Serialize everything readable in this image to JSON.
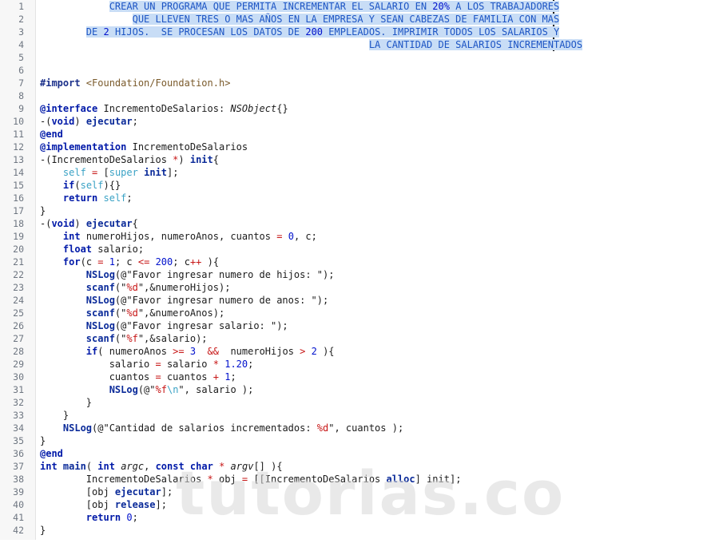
{
  "editor": {
    "watermark": "tutorias.co",
    "lines": [
      {
        "n": "1",
        "segs": [
          {
            "t": "            ",
            "c": ""
          },
          {
            "t": "CREAR UN PROGRAMA QUE PERMITA INCREMENTAR EL SALARIO EN ",
            "c": "c sel"
          },
          {
            "t": "20%",
            "c": "nm sel"
          },
          {
            "t": " A LOS TRABAJADORES",
            "c": "c sel"
          }
        ]
      },
      {
        "n": "2",
        "segs": [
          {
            "t": "                ",
            "c": ""
          },
          {
            "t": "QUE LLEVEN TRES O MAS AÑOS EN LA EMPRESA Y SEAN CABEZAS DE FAMILIA CON MAS",
            "c": "c sel"
          }
        ]
      },
      {
        "n": "3",
        "segs": [
          {
            "t": "        ",
            "c": ""
          },
          {
            "t": "DE ",
            "c": "c sel"
          },
          {
            "t": "2",
            "c": "nm sel"
          },
          {
            "t": " HIJOS.  SE PROCESAN LOS DATOS DE ",
            "c": "c sel"
          },
          {
            "t": "200",
            "c": "nm sel"
          },
          {
            "t": " EMPLEADOS. IMPRIMIR TODOS LOS SALARIOS Y",
            "c": "c sel"
          }
        ]
      },
      {
        "n": "4",
        "segs": [
          {
            "t": "                                                         ",
            "c": ""
          },
          {
            "t": "LA CANTIDAD DE SALARIOS INCREMENTADOS",
            "c": "c sel"
          }
        ]
      },
      {
        "n": "5",
        "segs": []
      },
      {
        "n": "6",
        "segs": []
      },
      {
        "n": "7",
        "segs": [
          {
            "t": "#import",
            "c": "dir"
          },
          {
            "t": " <Foundation/Foundation.h>",
            "c": "st"
          }
        ]
      },
      {
        "n": "8",
        "segs": []
      },
      {
        "n": "9",
        "segs": [
          {
            "t": "@interface",
            "c": "kw"
          },
          {
            "t": " IncrementoDeSalarios: ",
            "c": ""
          },
          {
            "t": "NSObject",
            "c": "it"
          },
          {
            "t": "{}",
            "c": ""
          }
        ]
      },
      {
        "n": "10",
        "segs": [
          {
            "t": "-(",
            "c": ""
          },
          {
            "t": "void",
            "c": "kw"
          },
          {
            "t": ") ",
            "c": ""
          },
          {
            "t": "ejecutar",
            "c": "fn"
          },
          {
            "t": ";",
            "c": ""
          }
        ]
      },
      {
        "n": "11",
        "segs": [
          {
            "t": "@end",
            "c": "kw"
          }
        ]
      },
      {
        "n": "12",
        "segs": [
          {
            "t": "@implementation",
            "c": "kw"
          },
          {
            "t": " IncrementoDeSalarios",
            "c": ""
          }
        ]
      },
      {
        "n": "13",
        "segs": [
          {
            "t": "-(IncrementoDeSalarios ",
            "c": ""
          },
          {
            "t": "*",
            "c": "op"
          },
          {
            "t": ") ",
            "c": ""
          },
          {
            "t": "init",
            "c": "fn"
          },
          {
            "t": "{",
            "c": ""
          }
        ]
      },
      {
        "n": "14",
        "segs": [
          {
            "t": "    ",
            "c": ""
          },
          {
            "t": "self",
            "c": "sf"
          },
          {
            "t": " ",
            "c": ""
          },
          {
            "t": "=",
            "c": "op"
          },
          {
            "t": " [",
            "c": ""
          },
          {
            "t": "super",
            "c": "sf"
          },
          {
            "t": " ",
            "c": ""
          },
          {
            "t": "init",
            "c": "fn"
          },
          {
            "t": "];",
            "c": ""
          }
        ]
      },
      {
        "n": "15",
        "segs": [
          {
            "t": "    ",
            "c": ""
          },
          {
            "t": "if",
            "c": "kw"
          },
          {
            "t": "(",
            "c": ""
          },
          {
            "t": "self",
            "c": "sf"
          },
          {
            "t": "){}",
            "c": ""
          }
        ]
      },
      {
        "n": "16",
        "segs": [
          {
            "t": "    ",
            "c": ""
          },
          {
            "t": "return",
            "c": "kw"
          },
          {
            "t": " ",
            "c": ""
          },
          {
            "t": "self",
            "c": "sf"
          },
          {
            "t": ";",
            "c": ""
          }
        ]
      },
      {
        "n": "17",
        "segs": [
          {
            "t": "}",
            "c": ""
          }
        ]
      },
      {
        "n": "18",
        "segs": [
          {
            "t": "-(",
            "c": ""
          },
          {
            "t": "void",
            "c": "kw"
          },
          {
            "t": ") ",
            "c": ""
          },
          {
            "t": "ejecutar",
            "c": "fn"
          },
          {
            "t": "{",
            "c": ""
          }
        ]
      },
      {
        "n": "19",
        "segs": [
          {
            "t": "    ",
            "c": ""
          },
          {
            "t": "int",
            "c": "kw"
          },
          {
            "t": " numeroHijos, numeroAnos, cuantos ",
            "c": ""
          },
          {
            "t": "=",
            "c": "op"
          },
          {
            "t": " ",
            "c": ""
          },
          {
            "t": "0",
            "c": "nm"
          },
          {
            "t": ", c;",
            "c": ""
          }
        ]
      },
      {
        "n": "20",
        "segs": [
          {
            "t": "    ",
            "c": ""
          },
          {
            "t": "float",
            "c": "kw"
          },
          {
            "t": " salario;",
            "c": ""
          }
        ]
      },
      {
        "n": "21",
        "segs": [
          {
            "t": "    ",
            "c": ""
          },
          {
            "t": "for",
            "c": "kw"
          },
          {
            "t": "(c ",
            "c": ""
          },
          {
            "t": "=",
            "c": "op"
          },
          {
            "t": " ",
            "c": ""
          },
          {
            "t": "1",
            "c": "nm"
          },
          {
            "t": "; c ",
            "c": ""
          },
          {
            "t": "<=",
            "c": "op"
          },
          {
            "t": " ",
            "c": ""
          },
          {
            "t": "200",
            "c": "nm"
          },
          {
            "t": "; c",
            "c": ""
          },
          {
            "t": "++",
            "c": "op"
          },
          {
            "t": " ){",
            "c": ""
          }
        ]
      },
      {
        "n": "22",
        "segs": [
          {
            "t": "        ",
            "c": ""
          },
          {
            "t": "NSLog",
            "c": "fn"
          },
          {
            "t": "(@\"Favor ingresar numero de hijos: \");",
            "c": "st2"
          }
        ]
      },
      {
        "n": "23",
        "segs": [
          {
            "t": "        ",
            "c": ""
          },
          {
            "t": "scanf",
            "c": "fn"
          },
          {
            "t": "(\"",
            "c": ""
          },
          {
            "t": "%d",
            "c": "fm"
          },
          {
            "t": "\",&numeroHijos);",
            "c": ""
          }
        ]
      },
      {
        "n": "24",
        "segs": [
          {
            "t": "        ",
            "c": ""
          },
          {
            "t": "NSLog",
            "c": "fn"
          },
          {
            "t": "(@\"Favor ingresar numero de anos: \");",
            "c": "st2"
          }
        ]
      },
      {
        "n": "25",
        "segs": [
          {
            "t": "        ",
            "c": ""
          },
          {
            "t": "scanf",
            "c": "fn"
          },
          {
            "t": "(\"",
            "c": ""
          },
          {
            "t": "%d",
            "c": "fm"
          },
          {
            "t": "\",&numeroAnos);",
            "c": ""
          }
        ]
      },
      {
        "n": "26",
        "segs": [
          {
            "t": "        ",
            "c": ""
          },
          {
            "t": "NSLog",
            "c": "fn"
          },
          {
            "t": "(@\"Favor ingresar salario: \");",
            "c": "st2"
          }
        ]
      },
      {
        "n": "27",
        "segs": [
          {
            "t": "        ",
            "c": ""
          },
          {
            "t": "scanf",
            "c": "fn"
          },
          {
            "t": "(\"",
            "c": ""
          },
          {
            "t": "%f",
            "c": "fm"
          },
          {
            "t": "\",&salario);",
            "c": ""
          }
        ]
      },
      {
        "n": "28",
        "segs": [
          {
            "t": "        ",
            "c": ""
          },
          {
            "t": "if",
            "c": "kw"
          },
          {
            "t": "( numeroAnos ",
            "c": ""
          },
          {
            "t": ">=",
            "c": "op"
          },
          {
            "t": " ",
            "c": ""
          },
          {
            "t": "3",
            "c": "nm"
          },
          {
            "t": "  ",
            "c": ""
          },
          {
            "t": "&&",
            "c": "op"
          },
          {
            "t": "  numeroHijos ",
            "c": ""
          },
          {
            "t": ">",
            "c": "op"
          },
          {
            "t": " ",
            "c": ""
          },
          {
            "t": "2",
            "c": "nm"
          },
          {
            "t": " ){",
            "c": ""
          }
        ]
      },
      {
        "n": "29",
        "segs": [
          {
            "t": "            salario ",
            "c": ""
          },
          {
            "t": "=",
            "c": "op"
          },
          {
            "t": " salario ",
            "c": ""
          },
          {
            "t": "*",
            "c": "op"
          },
          {
            "t": " ",
            "c": ""
          },
          {
            "t": "1.20",
            "c": "nm"
          },
          {
            "t": ";",
            "c": ""
          }
        ]
      },
      {
        "n": "30",
        "segs": [
          {
            "t": "            cuantos ",
            "c": ""
          },
          {
            "t": "=",
            "c": "op"
          },
          {
            "t": " cuantos ",
            "c": ""
          },
          {
            "t": "+",
            "c": "op"
          },
          {
            "t": " ",
            "c": ""
          },
          {
            "t": "1",
            "c": "nm"
          },
          {
            "t": ";",
            "c": ""
          }
        ]
      },
      {
        "n": "31",
        "segs": [
          {
            "t": "            ",
            "c": ""
          },
          {
            "t": "NSLog",
            "c": "fn"
          },
          {
            "t": "(@\"",
            "c": ""
          },
          {
            "t": "%f",
            "c": "fm"
          },
          {
            "t": "\\n",
            "c": "sf"
          },
          {
            "t": "\", salario );",
            "c": ""
          }
        ]
      },
      {
        "n": "32",
        "segs": [
          {
            "t": "        }",
            "c": ""
          }
        ]
      },
      {
        "n": "33",
        "segs": [
          {
            "t": "    }",
            "c": ""
          }
        ]
      },
      {
        "n": "34",
        "segs": [
          {
            "t": "    ",
            "c": ""
          },
          {
            "t": "NSLog",
            "c": "fn"
          },
          {
            "t": "(@\"Cantidad de salarios incrementados: ",
            "c": "st2"
          },
          {
            "t": "%d",
            "c": "fm"
          },
          {
            "t": "\", cuantos );",
            "c": ""
          }
        ]
      },
      {
        "n": "35",
        "segs": [
          {
            "t": "}",
            "c": ""
          }
        ]
      },
      {
        "n": "36",
        "segs": [
          {
            "t": "@end",
            "c": "kw"
          }
        ]
      },
      {
        "n": "37",
        "segs": [
          {
            "t": "int",
            "c": "kw"
          },
          {
            "t": " ",
            "c": ""
          },
          {
            "t": "main",
            "c": "fn"
          },
          {
            "t": "( ",
            "c": ""
          },
          {
            "t": "int",
            "c": "kw"
          },
          {
            "t": " ",
            "c": ""
          },
          {
            "t": "argc",
            "c": "it"
          },
          {
            "t": ", ",
            "c": ""
          },
          {
            "t": "const",
            "c": "kw"
          },
          {
            "t": " ",
            "c": ""
          },
          {
            "t": "char",
            "c": "kw"
          },
          {
            "t": " ",
            "c": ""
          },
          {
            "t": "*",
            "c": "op"
          },
          {
            "t": " ",
            "c": ""
          },
          {
            "t": "argv",
            "c": "it"
          },
          {
            "t": "[] ){",
            "c": ""
          }
        ]
      },
      {
        "n": "38",
        "segs": [
          {
            "t": "        IncrementoDeSalarios ",
            "c": ""
          },
          {
            "t": "*",
            "c": "op"
          },
          {
            "t": " obj ",
            "c": ""
          },
          {
            "t": "=",
            "c": "op"
          },
          {
            "t": " [[IncrementoDeSalarios ",
            "c": ""
          },
          {
            "t": "alloc",
            "c": "fn"
          },
          {
            "t": "] init];",
            "c": ""
          }
        ]
      },
      {
        "n": "39",
        "segs": [
          {
            "t": "        [obj ",
            "c": ""
          },
          {
            "t": "ejecutar",
            "c": "fn"
          },
          {
            "t": "];",
            "c": ""
          }
        ]
      },
      {
        "n": "40",
        "segs": [
          {
            "t": "        [obj ",
            "c": ""
          },
          {
            "t": "release",
            "c": "fn"
          },
          {
            "t": "];",
            "c": ""
          }
        ]
      },
      {
        "n": "41",
        "segs": [
          {
            "t": "        ",
            "c": ""
          },
          {
            "t": "return",
            "c": "kw"
          },
          {
            "t": " ",
            "c": ""
          },
          {
            "t": "0",
            "c": "nm"
          },
          {
            "t": ";",
            "c": ""
          }
        ]
      },
      {
        "n": "42",
        "segs": [
          {
            "t": "}",
            "c": ""
          }
        ]
      }
    ]
  }
}
